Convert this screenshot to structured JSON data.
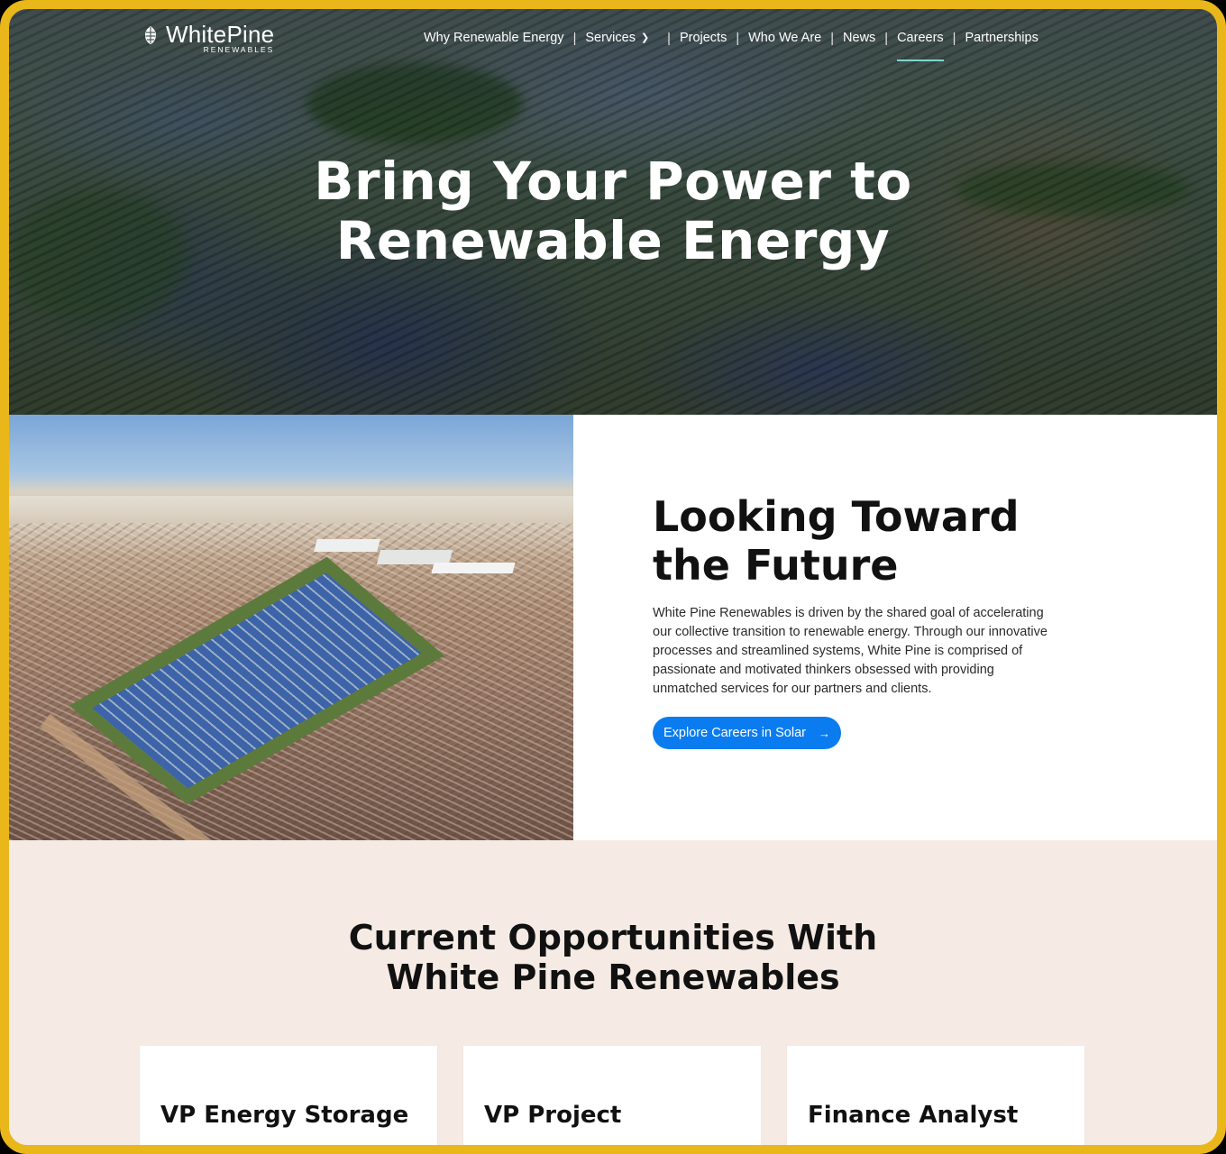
{
  "logo": {
    "name": "WhitePine",
    "sub": "RENEWABLES"
  },
  "nav": {
    "items": [
      {
        "label": "Why Renewable Energy"
      },
      {
        "label": "Services"
      },
      {
        "label": "Projects"
      },
      {
        "label": "Who We Are"
      },
      {
        "label": "News"
      },
      {
        "label": "Careers",
        "active": true
      },
      {
        "label": "Partnerships"
      }
    ]
  },
  "hero": {
    "title_line1": "Bring Your Power to",
    "title_line2": "Renewable Energy"
  },
  "future": {
    "title_line1": "Looking Toward",
    "title_line2": "the Future",
    "body": "White Pine Renewables is driven by the shared goal of accelerating our collective transition to renewable energy. Through our innovative processes and streamlined systems, White Pine is comprised of passionate and motivated thinkers obsessed with providing unmatched services for our partners and clients.",
    "button_label": "Explore Careers in Solar"
  },
  "opportunities": {
    "title_line1": "Current Opportunities With",
    "title_line2": "White Pine Renewables",
    "cards": [
      {
        "title": "VP Energy Storage"
      },
      {
        "title": "VP Project"
      },
      {
        "title": "Finance Analyst"
      }
    ]
  },
  "colors": {
    "frame": "#e9b71a",
    "accent_button": "#0a7cf0",
    "nav_active": "#7fd6d0",
    "section_bg": "#f5ebe4"
  },
  "icons": {
    "logo": "pine-cone-icon",
    "services_dropdown": "chevron-down-icon",
    "button_arrow": "arrow-right-icon"
  }
}
